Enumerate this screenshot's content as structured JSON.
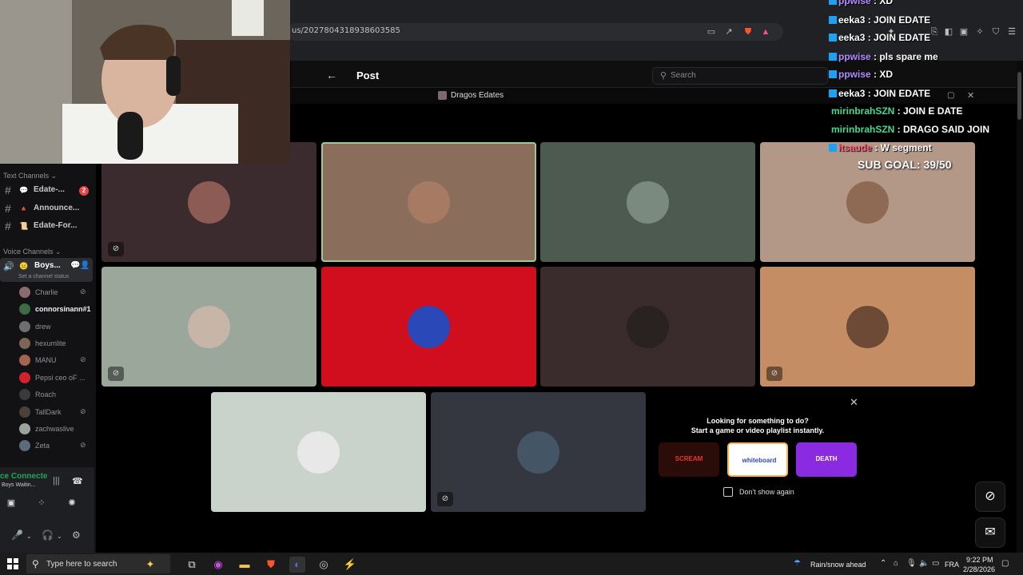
{
  "browser": {
    "url": "us/2027804318938603585"
  },
  "post": {
    "title": "Post",
    "search_placeholder": "Search",
    "voice_title": "Dragos Edates"
  },
  "sidebar": {
    "text_channels_label": "Text Channels",
    "text_channels": [
      {
        "label": "Edate-...",
        "emoji": "💬",
        "badge": "2"
      },
      {
        "label": "Announce...",
        "emoji": "🔺"
      },
      {
        "label": "Edate-For...",
        "emoji": "📜"
      }
    ],
    "voice_channels_label": "Voice Channels",
    "voice_channel": {
      "label": "Boys...",
      "emoji": "😐",
      "status": "Set a channel status"
    },
    "members": [
      {
        "name": "Charlie",
        "muted": true,
        "color": "#8a6c6c"
      },
      {
        "name": "connorsinann#1",
        "muted": false,
        "color": "#3c6b44",
        "live": true
      },
      {
        "name": "drew",
        "muted": false,
        "color": "#6e6e6e"
      },
      {
        "name": "hexumlite",
        "muted": false,
        "color": "#7b6655"
      },
      {
        "name": "MANU",
        "muted": true,
        "color": "#a2664e"
      },
      {
        "name": "Pepsi ceo oF ...",
        "muted": false,
        "color": "#d1232f"
      },
      {
        "name": "Roach",
        "muted": false,
        "color": "#3a3a3a"
      },
      {
        "name": "TallDark",
        "muted": true,
        "color": "#4d3f3a"
      },
      {
        "name": "zachwaslive",
        "muted": false,
        "color": "#9aa39a"
      },
      {
        "name": "Zeta",
        "muted": true,
        "color": "#5b6b7b"
      }
    ],
    "voice_connected": "ce Connecte",
    "voice_connected_sub": "Boys Waitin..."
  },
  "tiles": [
    {
      "name": "tile-1",
      "bg": "#3b2a2e",
      "avatar": "#8c5b53",
      "muted": true
    },
    {
      "name": "tile-2",
      "bg": "#8b6d5c",
      "avatar": "#a77a63",
      "muted": false,
      "speaking": true
    },
    {
      "name": "tile-3",
      "bg": "#4d5a4f",
      "avatar": "#7a8a7e",
      "muted": false
    },
    {
      "name": "tile-4",
      "bg": "#b39888",
      "avatar": "#8e6a55",
      "muted": false
    },
    {
      "name": "tile-5",
      "bg": "#9ba79b",
      "avatar": "#c7b5a8",
      "muted": true
    },
    {
      "name": "tile-6",
      "bg": "#d10e1e",
      "avatar": "#2a48b8",
      "muted": false
    },
    {
      "name": "tile-7",
      "bg": "#3a2c2d",
      "avatar": "#2a2220",
      "muted": false
    },
    {
      "name": "tile-8",
      "bg": "#c58d64",
      "avatar": "#6d4a35",
      "muted": true
    },
    {
      "name": "tile-9",
      "bg": "#c9d2cb",
      "avatar": "#e8e8e8",
      "muted": false
    },
    {
      "name": "tile-10",
      "bg": "#34373f",
      "avatar": "#445566",
      "muted": true
    }
  ],
  "activity": {
    "title_line1": "Looking for something to do?",
    "title_line2": "Start a game or video playlist instantly.",
    "cards": [
      {
        "label": "SCREAM",
        "bg": "#2a0c08"
      },
      {
        "label": "whiteboard",
        "bg": "#ffffff"
      },
      {
        "label": "DEATH",
        "bg": "#8a2be2"
      }
    ],
    "dont_show": "Don't show again"
  },
  "chat": {
    "lines": [
      {
        "user": "ppwise",
        "text": " : XD",
        "color": "#b48cff"
      },
      {
        "user": "eeka3",
        "text": " : JOIN EDATE",
        "color": "#ffffff"
      },
      {
        "user": "eeka3",
        "text": " : JOIN EDATE",
        "color": "#ffffff"
      },
      {
        "user": "ppwise",
        "text": " : pls spare me",
        "color": "#b48cff"
      },
      {
        "user": "ppwise",
        "text": " : XD",
        "color": "#b48cff"
      },
      {
        "user": "eeka3",
        "text": " : JOIN EDATE",
        "color": "#ffffff"
      },
      {
        "user": "mirinbrahSZN",
        "text": " : JOIN E DATE",
        "color": "#3ddc97"
      },
      {
        "user": "mirinbrahSZN",
        "text": " : DRAGO SAID JOIN",
        "color": "#3ddc97"
      },
      {
        "user": "itsaude",
        "text": " : W segment",
        "color": "#ff5a7a"
      }
    ],
    "sub_goal": "SUB GOAL: 39/50"
  },
  "taskbar": {
    "search_placeholder": "Type here to search",
    "weather": "Rain/snow ahead",
    "lang": "FRA",
    "time": "9:22 PM",
    "date": "2/28/2026"
  }
}
